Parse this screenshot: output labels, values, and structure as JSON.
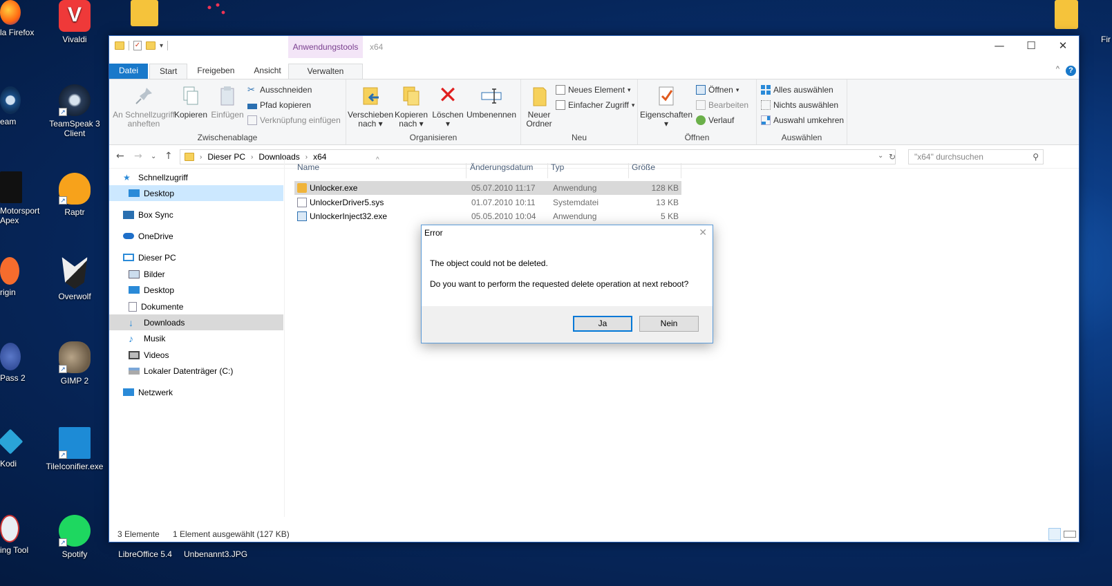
{
  "desktop": {
    "icons": [
      {
        "label": "Vivaldi"
      },
      {
        "label": "TeamSpeak 3 Client"
      },
      {
        "label": "Raptr"
      },
      {
        "label": "Overwolf"
      },
      {
        "label": "GIMP 2"
      },
      {
        "label": "TileIconifier.exe"
      },
      {
        "label": "Spotify"
      },
      {
        "label": "LibreOffice 5.4"
      },
      {
        "label": "Unbenannt3.JPG"
      }
    ],
    "left_cut": [
      {
        "label": "la Firefox"
      },
      {
        "label": "eam"
      },
      {
        "label": "Motorsport Apex"
      },
      {
        "label": "rigin"
      },
      {
        "label": "Pass 2"
      },
      {
        "label": "Kodi"
      },
      {
        "label": "ing Tool"
      }
    ],
    "right_cut_label": "Fir"
  },
  "window": {
    "context_tab": "Anwendungstools",
    "title": "x64",
    "tabs": {
      "file": "Datei",
      "start": "Start",
      "share": "Freigeben",
      "view": "Ansicht",
      "manage": "Verwalten"
    },
    "ribbon": {
      "clipboard": {
        "label": "Zwischenablage",
        "pin": "An Schnellzugriff anheften",
        "copy": "Kopieren",
        "paste": "Einfügen",
        "cut": "Ausschneiden",
        "copy_path": "Pfad kopieren",
        "paste_shortcut": "Verknüpfung einfügen"
      },
      "organize": {
        "label": "Organisieren",
        "move": "Verschieben nach",
        "copy_to": "Kopieren nach",
        "delete": "Löschen",
        "rename": "Umbenennen"
      },
      "new": {
        "label": "Neu",
        "new_folder": "Neuer Ordner",
        "new_item": "Neues Element",
        "easy_access": "Einfacher Zugriff"
      },
      "open": {
        "label": "Öffnen",
        "properties": "Eigenschaften",
        "open": "Öffnen",
        "edit": "Bearbeiten",
        "history": "Verlauf"
      },
      "select": {
        "label": "Auswählen",
        "all": "Alles auswählen",
        "none": "Nichts auswählen",
        "invert": "Auswahl umkehren"
      }
    },
    "address": {
      "crumbs": [
        "Dieser PC",
        "Downloads",
        "x64"
      ]
    },
    "search_placeholder": "\"x64\" durchsuchen",
    "nav": [
      {
        "label": "Schnellzugriff"
      },
      {
        "label": "Desktop"
      },
      {
        "label": "Box Sync"
      },
      {
        "label": "OneDrive"
      },
      {
        "label": "Dieser PC"
      },
      {
        "label": "Bilder"
      },
      {
        "label": "Desktop"
      },
      {
        "label": "Dokumente"
      },
      {
        "label": "Downloads"
      },
      {
        "label": "Musik"
      },
      {
        "label": "Videos"
      },
      {
        "label": "Lokaler Datenträger (C:)"
      },
      {
        "label": "Netzwerk"
      }
    ],
    "columns": {
      "name": "Name",
      "date": "Änderungsdatum",
      "type": "Typ",
      "size": "Größe"
    },
    "files": [
      {
        "name": "Unlocker.exe",
        "date": "05.07.2010 11:17",
        "type": "Anwendung",
        "size": "128 KB"
      },
      {
        "name": "UnlockerDriver5.sys",
        "date": "01.07.2010 10:11",
        "type": "Systemdatei",
        "size": "13 KB"
      },
      {
        "name": "UnlockerInject32.exe",
        "date": "05.05.2010 10:04",
        "type": "Anwendung",
        "size": "5 KB"
      }
    ],
    "status": {
      "count": "3 Elemente",
      "selection": "1 Element ausgewählt (127 KB)"
    }
  },
  "dialog": {
    "title": "Error",
    "line1": "The object could not be deleted.",
    "line2": "Do you want to perform the requested delete operation at next reboot?",
    "yes": "Ja",
    "no": "Nein"
  }
}
